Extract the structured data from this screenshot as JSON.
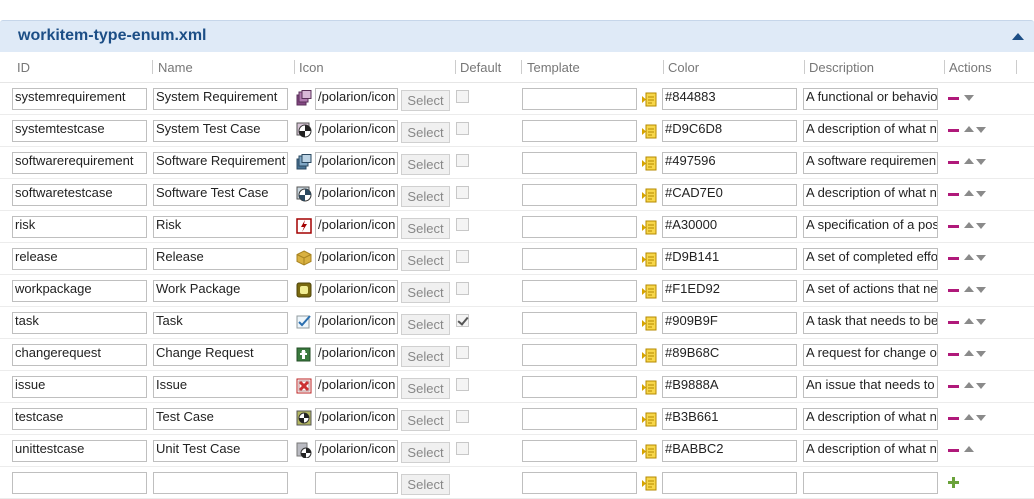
{
  "panel": {
    "title": "workitem-type-enum.xml"
  },
  "columns": [
    "ID",
    "Name",
    "Icon",
    "Default",
    "Template",
    "Color",
    "Description",
    "Actions"
  ],
  "select_label": "Select",
  "rows": [
    {
      "id": "systemrequirement",
      "name": "System Requirement",
      "icon_path": "/polarion/icon",
      "icon": "system-requirement-icon",
      "icon_color": "#844883",
      "default": false,
      "template": "",
      "color": "#844883",
      "description": "A functional or behavio"
    },
    {
      "id": "systemtestcase",
      "name": "System Test Case",
      "icon_path": "/polarion/icon",
      "icon": "system-test-case-icon",
      "icon_color": "#D9C6D8",
      "default": false,
      "template": "",
      "color": "#D9C6D8",
      "description": "A description of what n"
    },
    {
      "id": "softwarerequirement",
      "name": "Software Requirement",
      "icon_path": "/polarion/icon",
      "icon": "software-requirement-icon",
      "icon_color": "#497596",
      "default": false,
      "template": "",
      "color": "#497596",
      "description": "A software requiremen"
    },
    {
      "id": "softwaretestcase",
      "name": "Software Test Case",
      "icon_path": "/polarion/icon",
      "icon": "software-test-case-icon",
      "icon_color": "#CAD7E0",
      "default": false,
      "template": "",
      "color": "#CAD7E0",
      "description": "A description of what n"
    },
    {
      "id": "risk",
      "name": "Risk",
      "icon_path": "/polarion/icon",
      "icon": "risk-icon",
      "icon_color": "#A30000",
      "default": false,
      "template": "",
      "color": "#A30000",
      "description": "A specification of a pos"
    },
    {
      "id": "release",
      "name": "Release",
      "icon_path": "/polarion/icon",
      "icon": "release-icon",
      "icon_color": "#D9B141",
      "default": false,
      "template": "",
      "color": "#D9B141",
      "description": "A set of completed effo"
    },
    {
      "id": "workpackage",
      "name": "Work Package",
      "icon_path": "/polarion/icon",
      "icon": "work-package-icon",
      "icon_color": "#F1ED92",
      "default": false,
      "template": "",
      "color": "#F1ED92",
      "description": "A set of actions that ne"
    },
    {
      "id": "task",
      "name": "Task",
      "icon_path": "/polarion/icon",
      "icon": "task-icon",
      "icon_color": "#909B9F",
      "default": true,
      "template": "",
      "color": "#909B9F",
      "description": "A task that needs to be"
    },
    {
      "id": "changerequest",
      "name": "Change Request",
      "icon_path": "/polarion/icon",
      "icon": "change-request-icon",
      "icon_color": "#89B68C",
      "default": false,
      "template": "",
      "color": "#89B68C",
      "description": "A request for change o"
    },
    {
      "id": "issue",
      "name": "Issue",
      "icon_path": "/polarion/icon",
      "icon": "issue-icon",
      "icon_color": "#B9888A",
      "default": false,
      "template": "",
      "color": "#B9888A",
      "description": "An issue that needs to"
    },
    {
      "id": "testcase",
      "name": "Test Case",
      "icon_path": "/polarion/icon",
      "icon": "test-case-icon",
      "icon_color": "#B3B661",
      "default": false,
      "template": "",
      "color": "#B3B661",
      "description": "A description of what n"
    },
    {
      "id": "unittestcase",
      "name": "Unit Test Case",
      "icon_path": "/polarion/icon",
      "icon": "unit-test-case-icon",
      "icon_color": "#BABBC2",
      "default": false,
      "template": "",
      "color": "#BABBC2",
      "description": "A description of what n"
    }
  ],
  "new_row": {
    "id": "",
    "name": "",
    "icon_path": "",
    "template": "",
    "color": "",
    "description": ""
  }
}
